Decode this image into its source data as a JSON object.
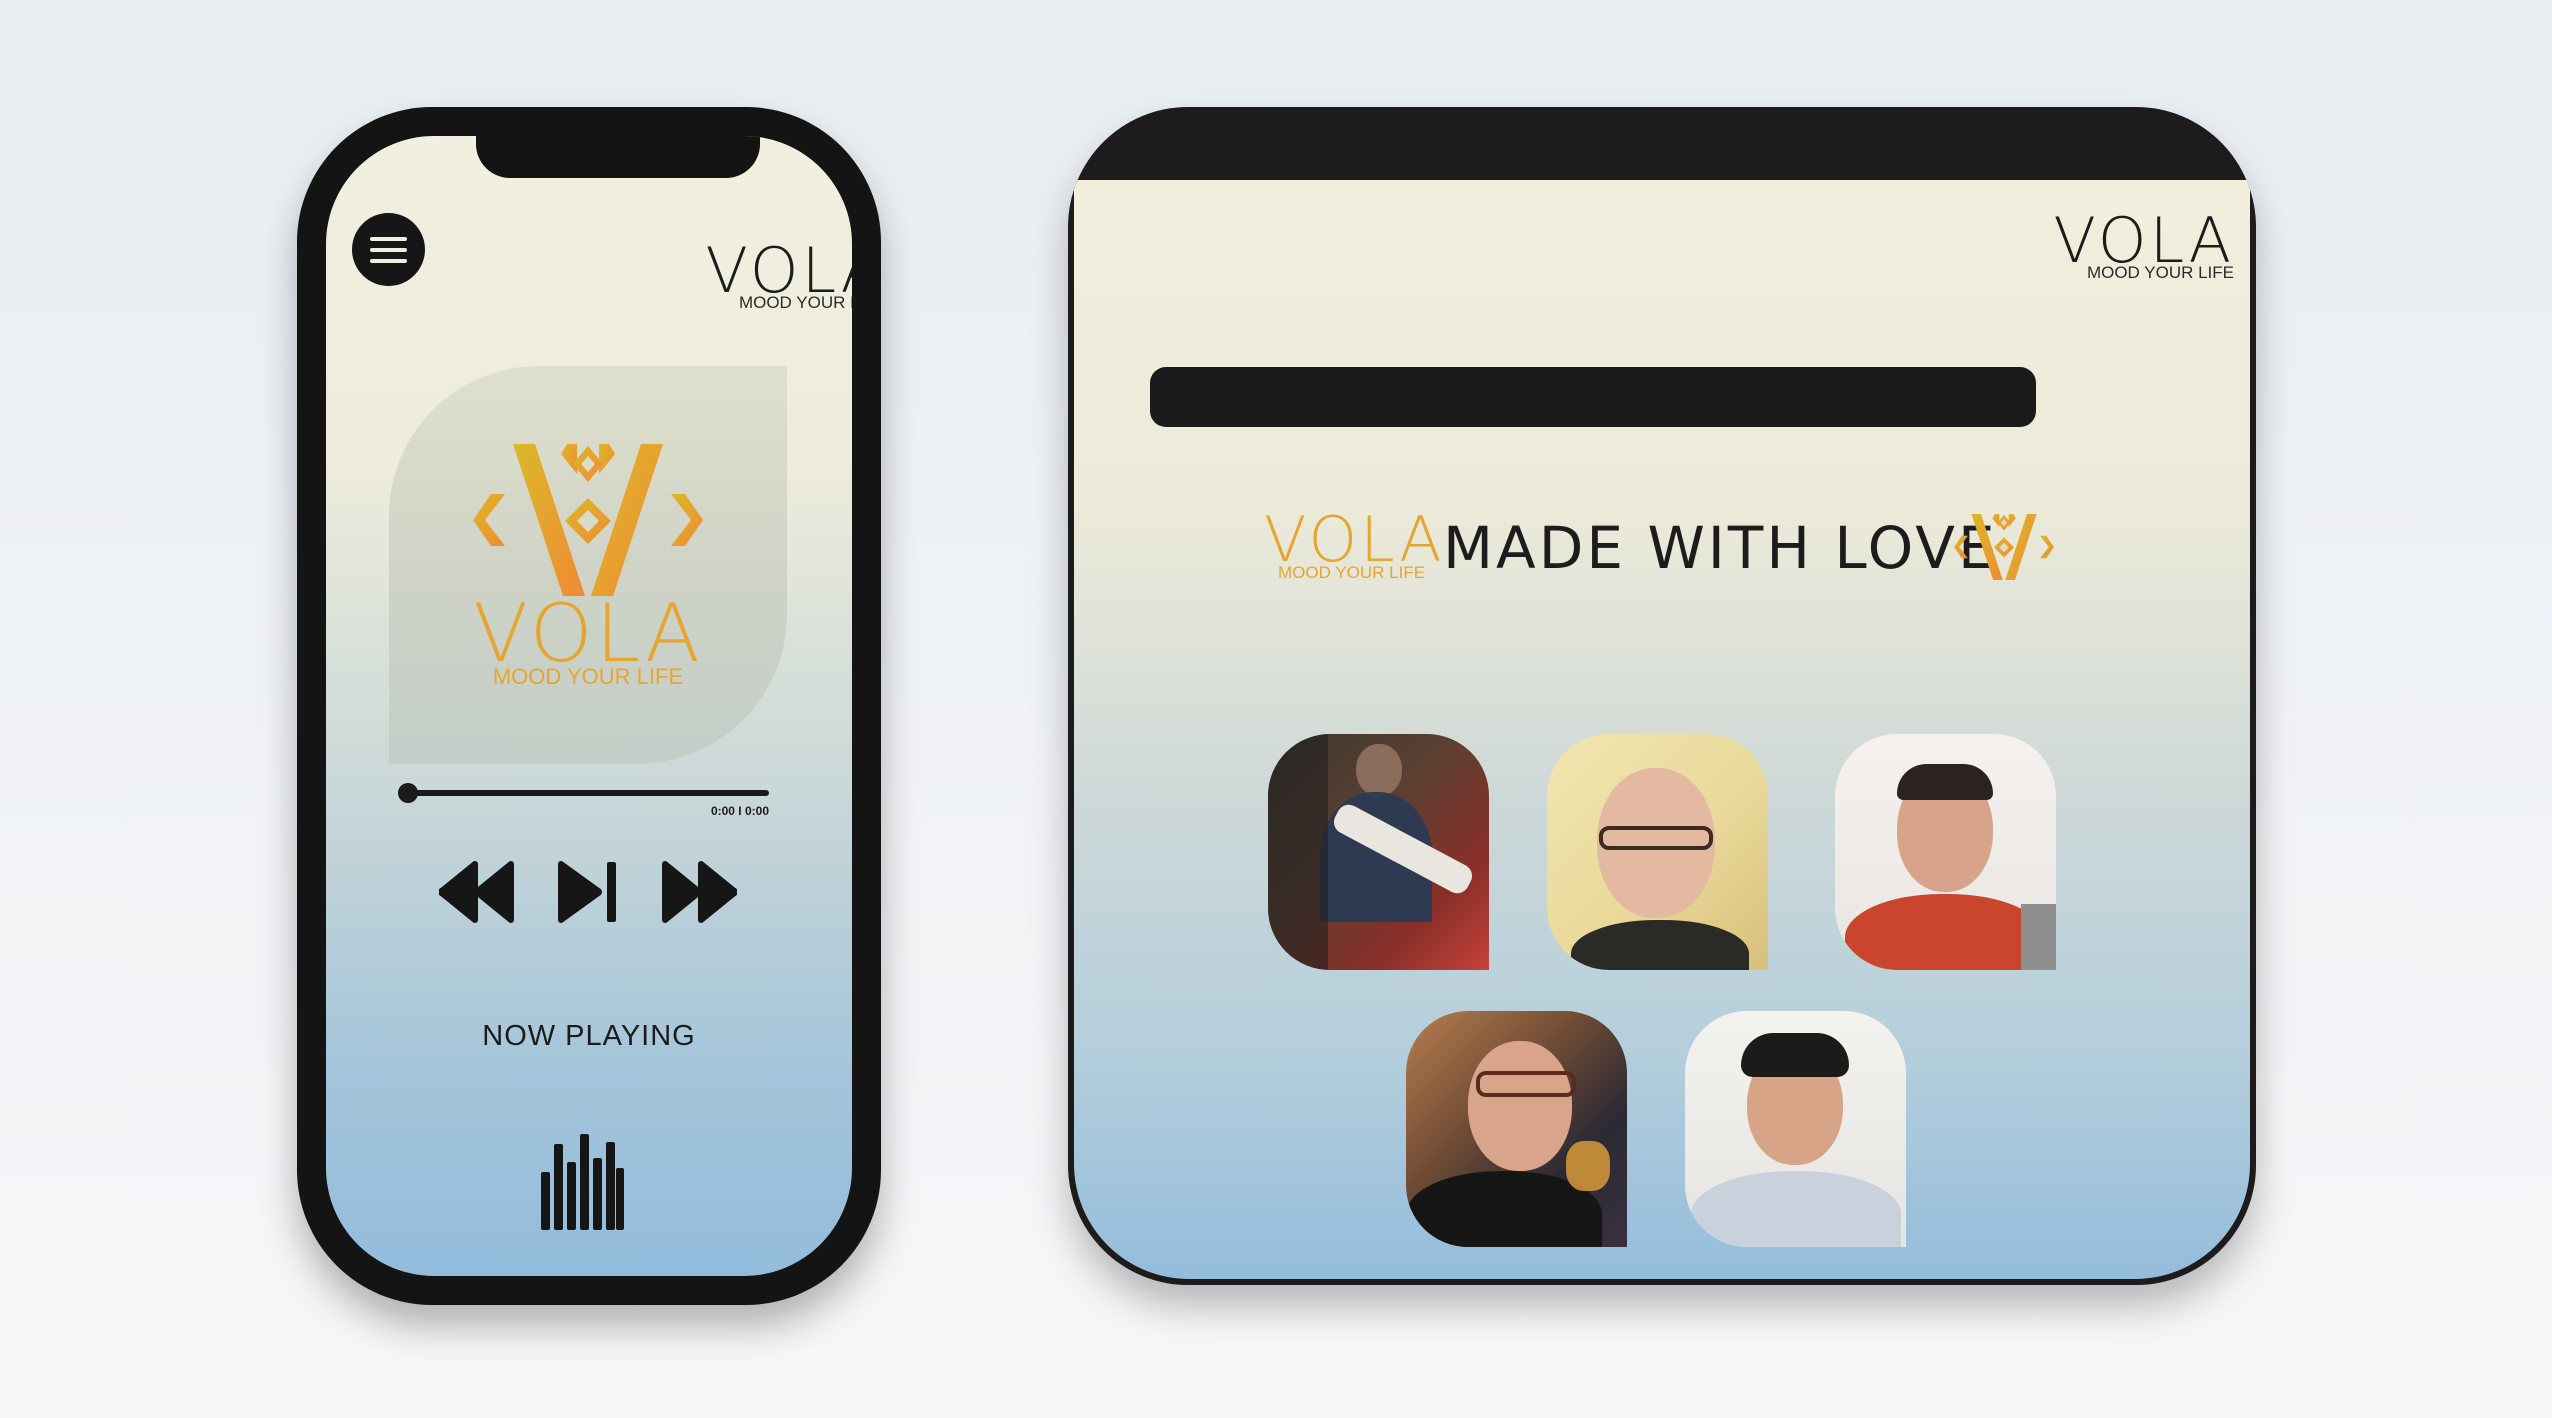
{
  "phone": {
    "menu_icon": "hamburger-menu-icon",
    "logo": {
      "word": "VOLA",
      "tagline": "MOOD YOUR LIFE"
    },
    "album_art": {
      "mark_icon": "vola-diamond-mark-icon",
      "word": "VOLA",
      "tagline": "MOOD YOUR LIFE"
    },
    "player": {
      "time": "0:00 I 0:00",
      "progress_fraction": 0,
      "controls": [
        {
          "name": "rewind",
          "icon": "rewind-icon"
        },
        {
          "name": "play-pause",
          "icon": "play-pause-icon"
        },
        {
          "name": "fast-forward",
          "icon": "fast-forward-icon"
        }
      ],
      "status": "NOW PLAYING",
      "visualizer_icon": "equalizer-bars-icon"
    }
  },
  "tablet": {
    "logo": {
      "word": "VOLA",
      "tagline": "MOOD YOUR LIFE"
    },
    "credits": {
      "logo": {
        "word": "VOLA",
        "tagline": "MOOD YOUR LIFE"
      },
      "title": "MADE WITH LOVE",
      "mark_icon": "vola-diamond-mark-icon",
      "team_photos": [
        {
          "id": "team-photo-1"
        },
        {
          "id": "team-photo-2"
        },
        {
          "id": "team-photo-3"
        },
        {
          "id": "team-photo-4"
        },
        {
          "id": "team-photo-5"
        }
      ]
    }
  },
  "colors": {
    "brand_gold": "#e5a531",
    "device_frame": "#141414",
    "screen_top": "#f1efdf",
    "screen_bottom": "#93bcdc"
  }
}
